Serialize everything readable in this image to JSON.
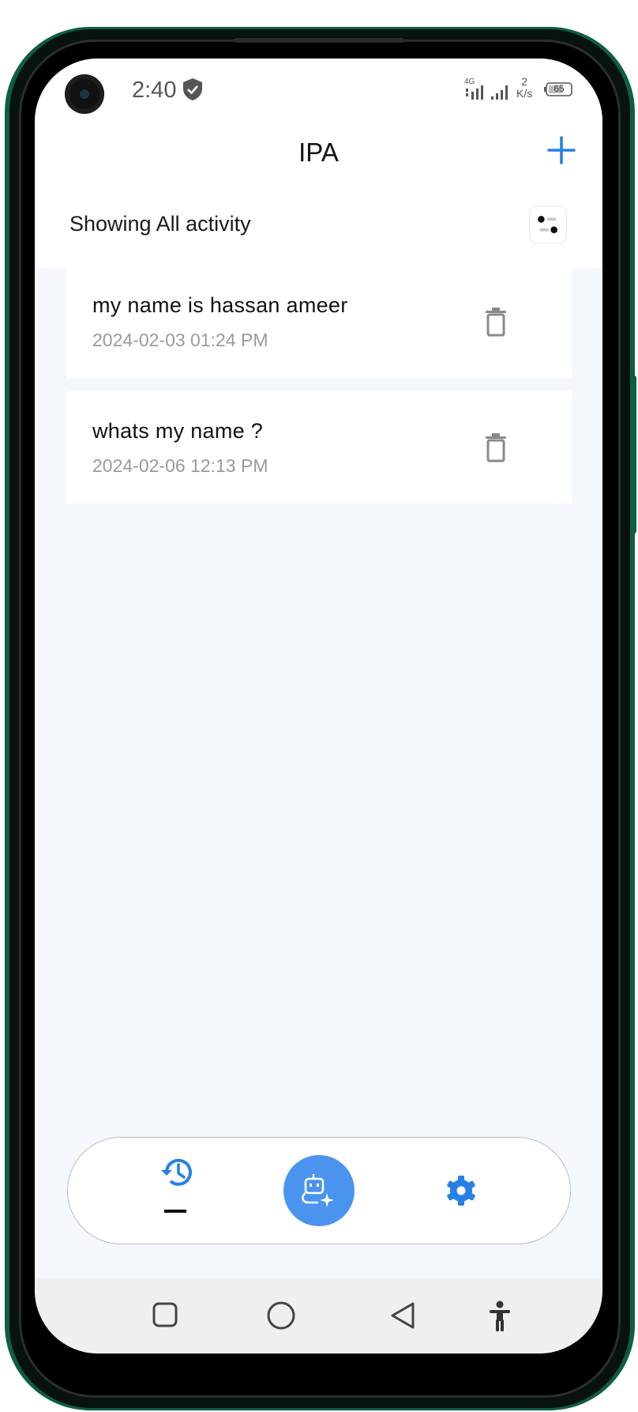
{
  "status_bar": {
    "time": "2:40",
    "network": "4G",
    "speed_value": "2",
    "speed_unit": "K/s",
    "battery": "65"
  },
  "header": {
    "title": "IPA",
    "add_icon": "plus-icon"
  },
  "filter": {
    "label": "Showing All activity",
    "icon": "filter-toggle-icon"
  },
  "activities": [
    {
      "title": "my name is hassan ameer",
      "date": "2024-02-03 01:24 PM"
    },
    {
      "title": "whats my name ?",
      "date": "2024-02-06 12:13 PM"
    }
  ],
  "bottom_nav": {
    "items": [
      {
        "name": "history",
        "icon": "history-icon",
        "active": true
      },
      {
        "name": "assistant",
        "icon": "robot-sparkle-icon",
        "active": false
      },
      {
        "name": "settings",
        "icon": "gear-icon",
        "active": false
      }
    ]
  },
  "system_nav": {
    "items": [
      "recents-square-icon",
      "home-circle-icon",
      "back-triangle-icon",
      "accessibility-icon"
    ]
  },
  "colors": {
    "accent": "#2680e6",
    "assistant_button": "#4a94ef",
    "screen_background": "#f4f8fd",
    "phone_frame": "#0d5e45"
  }
}
